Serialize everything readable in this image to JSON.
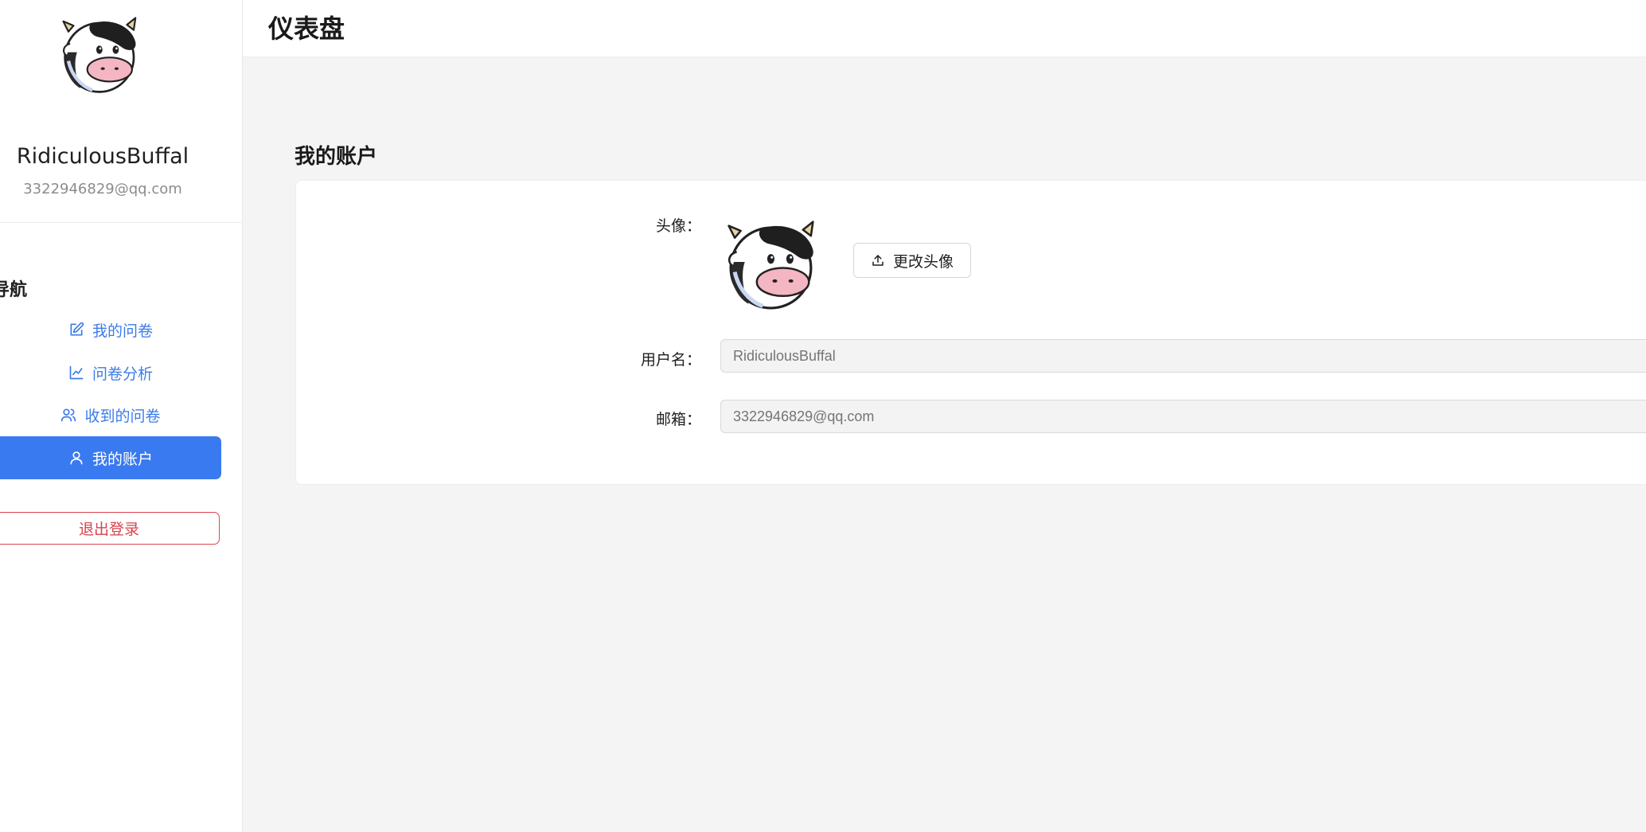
{
  "sidebar": {
    "avatar_icon": "cow-avatar",
    "username": "RidiculousBuffal",
    "email": "3322946829@qq.com",
    "section_title": "导航",
    "items": [
      {
        "label": "我的问卷",
        "icon": "edit-icon"
      },
      {
        "label": "问卷分析",
        "icon": "line-chart-icon"
      },
      {
        "label": "收到的问卷",
        "icon": "users-icon"
      },
      {
        "label": "我的账户",
        "icon": "user-icon",
        "active": true
      }
    ],
    "logout_label": "退出登录"
  },
  "header": {
    "title": "仪表盘"
  },
  "account": {
    "title": "我的账户",
    "avatar_label": "头像",
    "upload_button_label": "更改头像",
    "username_label": "用户名",
    "username_placeholder": "RidiculousBuffal",
    "email_label": "邮箱",
    "email_placeholder": "3322946829@qq.com"
  },
  "colors": {
    "accent": "#3a7af0",
    "link": "#3c7be8",
    "danger": "#d7434f",
    "background": "#f4f4f4"
  }
}
